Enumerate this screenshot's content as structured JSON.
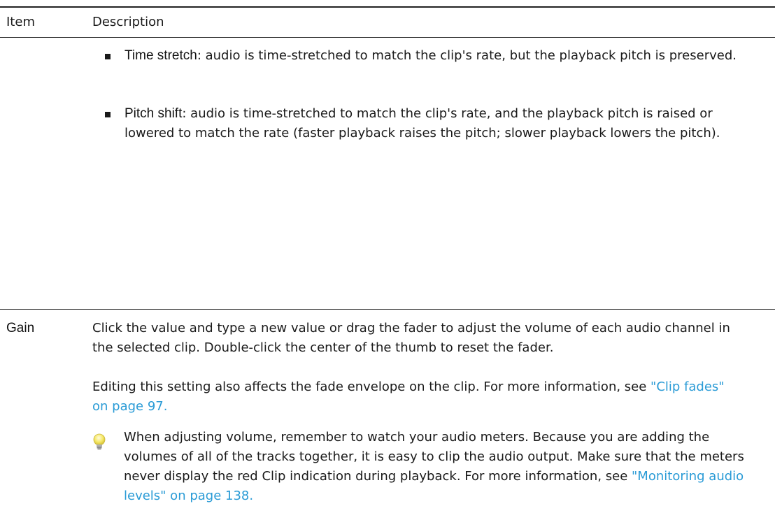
{
  "table": {
    "header": {
      "item": "Item",
      "description": "Description"
    },
    "bullets": [
      {
        "term": "Time stretch",
        "text": ": audio is time-stretched to match the clip's rate, but the playback pitch is preserved."
      },
      {
        "term": "Pitch shift",
        "text": ": audio is time-stretched to match the clip's rate, and the playback pitch is raised or lowered to match the rate (faster playback raises the pitch; slower playback lowers the pitch)."
      }
    ],
    "gain": {
      "label": "Gain",
      "para1": "Click the value and type a new value or drag the fader to adjust the volume of each audio channel in the selected clip. Double-click the center of the thumb to reset the fader.",
      "para2": "Editing this setting also affects the fade envelope on the clip. For more information, see ",
      "para2_link": "\"Clip fades\" on page 97.",
      "tip_text": "When adjusting volume, remember to watch your audio meters. Because you are adding the volumes of all of the tracks together, it is easy to clip the audio output. Make sure that the meters never display the red Clip indication during playback. For more information, see ",
      "tip_link": "\"Monitoring audio levels\" on page 138.",
      "tip_icon": "lightbulb-icon"
    }
  }
}
